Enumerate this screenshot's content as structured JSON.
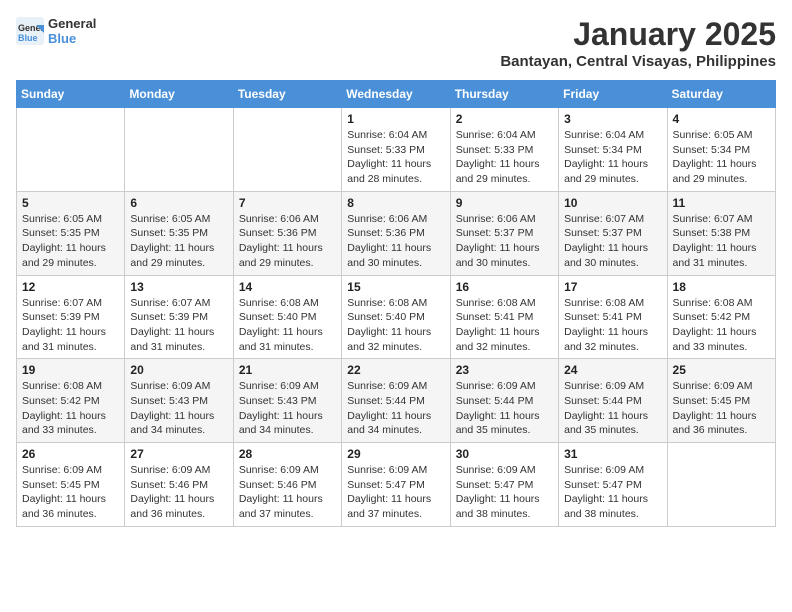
{
  "header": {
    "logo_line1": "General",
    "logo_line2": "Blue",
    "month": "January 2025",
    "location": "Bantayan, Central Visayas, Philippines"
  },
  "weekdays": [
    "Sunday",
    "Monday",
    "Tuesday",
    "Wednesday",
    "Thursday",
    "Friday",
    "Saturday"
  ],
  "weeks": [
    [
      {
        "day": "",
        "info": ""
      },
      {
        "day": "",
        "info": ""
      },
      {
        "day": "",
        "info": ""
      },
      {
        "day": "1",
        "info": "Sunrise: 6:04 AM\nSunset: 5:33 PM\nDaylight: 11 hours\nand 28 minutes."
      },
      {
        "day": "2",
        "info": "Sunrise: 6:04 AM\nSunset: 5:33 PM\nDaylight: 11 hours\nand 29 minutes."
      },
      {
        "day": "3",
        "info": "Sunrise: 6:04 AM\nSunset: 5:34 PM\nDaylight: 11 hours\nand 29 minutes."
      },
      {
        "day": "4",
        "info": "Sunrise: 6:05 AM\nSunset: 5:34 PM\nDaylight: 11 hours\nand 29 minutes."
      }
    ],
    [
      {
        "day": "5",
        "info": "Sunrise: 6:05 AM\nSunset: 5:35 PM\nDaylight: 11 hours\nand 29 minutes."
      },
      {
        "day": "6",
        "info": "Sunrise: 6:05 AM\nSunset: 5:35 PM\nDaylight: 11 hours\nand 29 minutes."
      },
      {
        "day": "7",
        "info": "Sunrise: 6:06 AM\nSunset: 5:36 PM\nDaylight: 11 hours\nand 29 minutes."
      },
      {
        "day": "8",
        "info": "Sunrise: 6:06 AM\nSunset: 5:36 PM\nDaylight: 11 hours\nand 30 minutes."
      },
      {
        "day": "9",
        "info": "Sunrise: 6:06 AM\nSunset: 5:37 PM\nDaylight: 11 hours\nand 30 minutes."
      },
      {
        "day": "10",
        "info": "Sunrise: 6:07 AM\nSunset: 5:37 PM\nDaylight: 11 hours\nand 30 minutes."
      },
      {
        "day": "11",
        "info": "Sunrise: 6:07 AM\nSunset: 5:38 PM\nDaylight: 11 hours\nand 31 minutes."
      }
    ],
    [
      {
        "day": "12",
        "info": "Sunrise: 6:07 AM\nSunset: 5:39 PM\nDaylight: 11 hours\nand 31 minutes."
      },
      {
        "day": "13",
        "info": "Sunrise: 6:07 AM\nSunset: 5:39 PM\nDaylight: 11 hours\nand 31 minutes."
      },
      {
        "day": "14",
        "info": "Sunrise: 6:08 AM\nSunset: 5:40 PM\nDaylight: 11 hours\nand 31 minutes."
      },
      {
        "day": "15",
        "info": "Sunrise: 6:08 AM\nSunset: 5:40 PM\nDaylight: 11 hours\nand 32 minutes."
      },
      {
        "day": "16",
        "info": "Sunrise: 6:08 AM\nSunset: 5:41 PM\nDaylight: 11 hours\nand 32 minutes."
      },
      {
        "day": "17",
        "info": "Sunrise: 6:08 AM\nSunset: 5:41 PM\nDaylight: 11 hours\nand 32 minutes."
      },
      {
        "day": "18",
        "info": "Sunrise: 6:08 AM\nSunset: 5:42 PM\nDaylight: 11 hours\nand 33 minutes."
      }
    ],
    [
      {
        "day": "19",
        "info": "Sunrise: 6:08 AM\nSunset: 5:42 PM\nDaylight: 11 hours\nand 33 minutes."
      },
      {
        "day": "20",
        "info": "Sunrise: 6:09 AM\nSunset: 5:43 PM\nDaylight: 11 hours\nand 34 minutes."
      },
      {
        "day": "21",
        "info": "Sunrise: 6:09 AM\nSunset: 5:43 PM\nDaylight: 11 hours\nand 34 minutes."
      },
      {
        "day": "22",
        "info": "Sunrise: 6:09 AM\nSunset: 5:44 PM\nDaylight: 11 hours\nand 34 minutes."
      },
      {
        "day": "23",
        "info": "Sunrise: 6:09 AM\nSunset: 5:44 PM\nDaylight: 11 hours\nand 35 minutes."
      },
      {
        "day": "24",
        "info": "Sunrise: 6:09 AM\nSunset: 5:44 PM\nDaylight: 11 hours\nand 35 minutes."
      },
      {
        "day": "25",
        "info": "Sunrise: 6:09 AM\nSunset: 5:45 PM\nDaylight: 11 hours\nand 36 minutes."
      }
    ],
    [
      {
        "day": "26",
        "info": "Sunrise: 6:09 AM\nSunset: 5:45 PM\nDaylight: 11 hours\nand 36 minutes."
      },
      {
        "day": "27",
        "info": "Sunrise: 6:09 AM\nSunset: 5:46 PM\nDaylight: 11 hours\nand 36 minutes."
      },
      {
        "day": "28",
        "info": "Sunrise: 6:09 AM\nSunset: 5:46 PM\nDaylight: 11 hours\nand 37 minutes."
      },
      {
        "day": "29",
        "info": "Sunrise: 6:09 AM\nSunset: 5:47 PM\nDaylight: 11 hours\nand 37 minutes."
      },
      {
        "day": "30",
        "info": "Sunrise: 6:09 AM\nSunset: 5:47 PM\nDaylight: 11 hours\nand 38 minutes."
      },
      {
        "day": "31",
        "info": "Sunrise: 6:09 AM\nSunset: 5:47 PM\nDaylight: 11 hours\nand 38 minutes."
      },
      {
        "day": "",
        "info": ""
      }
    ]
  ]
}
